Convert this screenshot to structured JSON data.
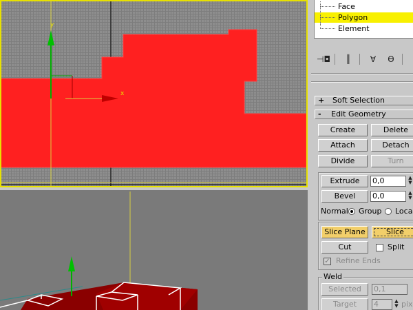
{
  "selection_tree": {
    "items": [
      {
        "label": "Face",
        "selected": false
      },
      {
        "label": "Polygon",
        "selected": true
      },
      {
        "label": "Element",
        "selected": false
      }
    ]
  },
  "viewport_top": {
    "axis_x_label": "x",
    "axis_y_label": "y",
    "colors": {
      "grid": "#8e8e8e",
      "mesh": "#ff2020",
      "active_border": "#e8e100",
      "axis_x": "#c80000",
      "axis_y": "#00c000"
    }
  },
  "viewport_perspective": {
    "colors": {
      "background": "#7a7a7a"
    }
  },
  "toolbar": {
    "icons": [
      "pin-stack-icon",
      "show-end-result-icon",
      "make-unique-icon",
      "remove-modifier-icon"
    ]
  },
  "soft_selection": {
    "sign": "+",
    "title": "Soft Selection"
  },
  "edit_geometry": {
    "sign": "-",
    "title": "Edit Geometry",
    "create_label": "Create",
    "delete_label": "Delete",
    "attach_label": "Attach",
    "detach_label": "Detach",
    "divide_label": "Divide",
    "turn_label": "Turn",
    "extrude_label": "Extrude",
    "extrude_value": "0,0",
    "bevel_label": "Bevel",
    "bevel_value": "0,0",
    "normal_label": "Normal:",
    "normal_group_label": "Group",
    "normal_local_label": "Loca",
    "slice_plane_label": "Slice Plane",
    "slice_label": "Slice",
    "cut_label": "Cut",
    "split_label": "Split",
    "refine_ends_label": "Refine Ends",
    "refine_ends_mark": "✓"
  },
  "weld": {
    "title": "Weld",
    "selected_label": "Selected",
    "selected_value": "0,1",
    "target_label": "Target",
    "target_value": "4",
    "target_unit": "pixe"
  }
}
